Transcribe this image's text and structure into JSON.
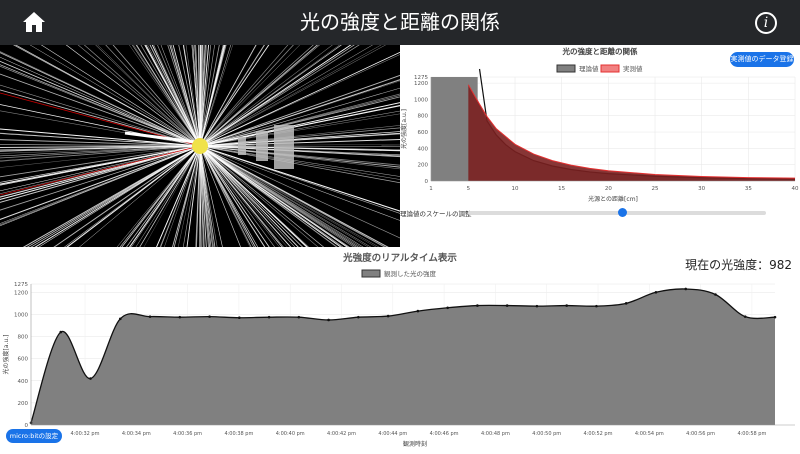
{
  "header": {
    "title": "光の強度と距離の関係"
  },
  "colors": {
    "header_bg": "#25272a",
    "accent": "#1a73e8",
    "theory_fill": "#808080",
    "actual_fill": "#7a2020",
    "actual_line": "#e53030"
  },
  "simulation": {
    "icon": "light-source-simulation"
  },
  "chart_data": [
    {
      "type": "area",
      "title": "光の強度と距離の関係",
      "xlabel": "光源との距離[cm]",
      "ylabel": "光の強度[a.u.]",
      "legend_position": "top",
      "grid": true,
      "xlim": [
        1,
        40
      ],
      "ylim": [
        0,
        1275
      ],
      "x_ticks": [
        "1",
        "5",
        "10",
        "15",
        "20",
        "25",
        "30",
        "35",
        "40"
      ],
      "y_ticks": [
        "0",
        "200",
        "400",
        "600",
        "800",
        "1000",
        "1200",
        "1275"
      ],
      "series": [
        {
          "name": "理論値",
          "color": "#808080",
          "x": [
            5,
            6,
            7,
            8,
            9,
            10,
            12,
            14,
            16,
            18,
            20,
            25,
            30,
            35,
            40
          ],
          "y": [
            1275,
            1000,
            736,
            563,
            445,
            360,
            250,
            184,
            141,
            111,
            90,
            58,
            40,
            29,
            23
          ]
        },
        {
          "name": "実測値",
          "color": "#e53030",
          "x": [
            5,
            6,
            7,
            8,
            10,
            12,
            14,
            16,
            18,
            20,
            25,
            30,
            35,
            40
          ],
          "y": [
            1180,
            980,
            790,
            640,
            450,
            330,
            250,
            195,
            155,
            125,
            80,
            55,
            42,
            35
          ]
        }
      ]
    },
    {
      "type": "area",
      "title": "光強度のリアルタイム表示",
      "xlabel": "観測時刻",
      "ylabel": "光の強度[a.u.]",
      "legend_position": "top",
      "grid": true,
      "ylim": [
        0,
        1275
      ],
      "y_ticks": [
        "0",
        "200",
        "400",
        "600",
        "800",
        "1000",
        "1200",
        "1275"
      ],
      "x_ticks": [
        "4:00:32 pm",
        "4:00:34 pm",
        "4:00:36 pm",
        "4:00:38 pm",
        "4:00:40 pm",
        "4:00:42 pm",
        "4:00:44 pm",
        "4:00:46 pm",
        "4:00:48 pm",
        "4:00:50 pm",
        "4:00:52 pm",
        "4:00:54 pm",
        "4:00:56 pm",
        "4:00:58 pm",
        "4"
      ],
      "series": [
        {
          "name": "観測した光の強度",
          "color": "#808080",
          "values": [
            20,
            840,
            420,
            960,
            980,
            975,
            980,
            970,
            975,
            975,
            950,
            975,
            985,
            1030,
            1060,
            1080,
            1080,
            1075,
            1080,
            1075,
            1100,
            1200,
            1230,
            1180,
            980,
            975
          ]
        }
      ]
    }
  ],
  "controls": {
    "register_button": "実測値のデータ登録",
    "slider_label": "理論値のスケールの調整",
    "slider_value": 0.52,
    "micro_button": "micro:bitの設定",
    "current_label": "現在の光強度：982"
  }
}
